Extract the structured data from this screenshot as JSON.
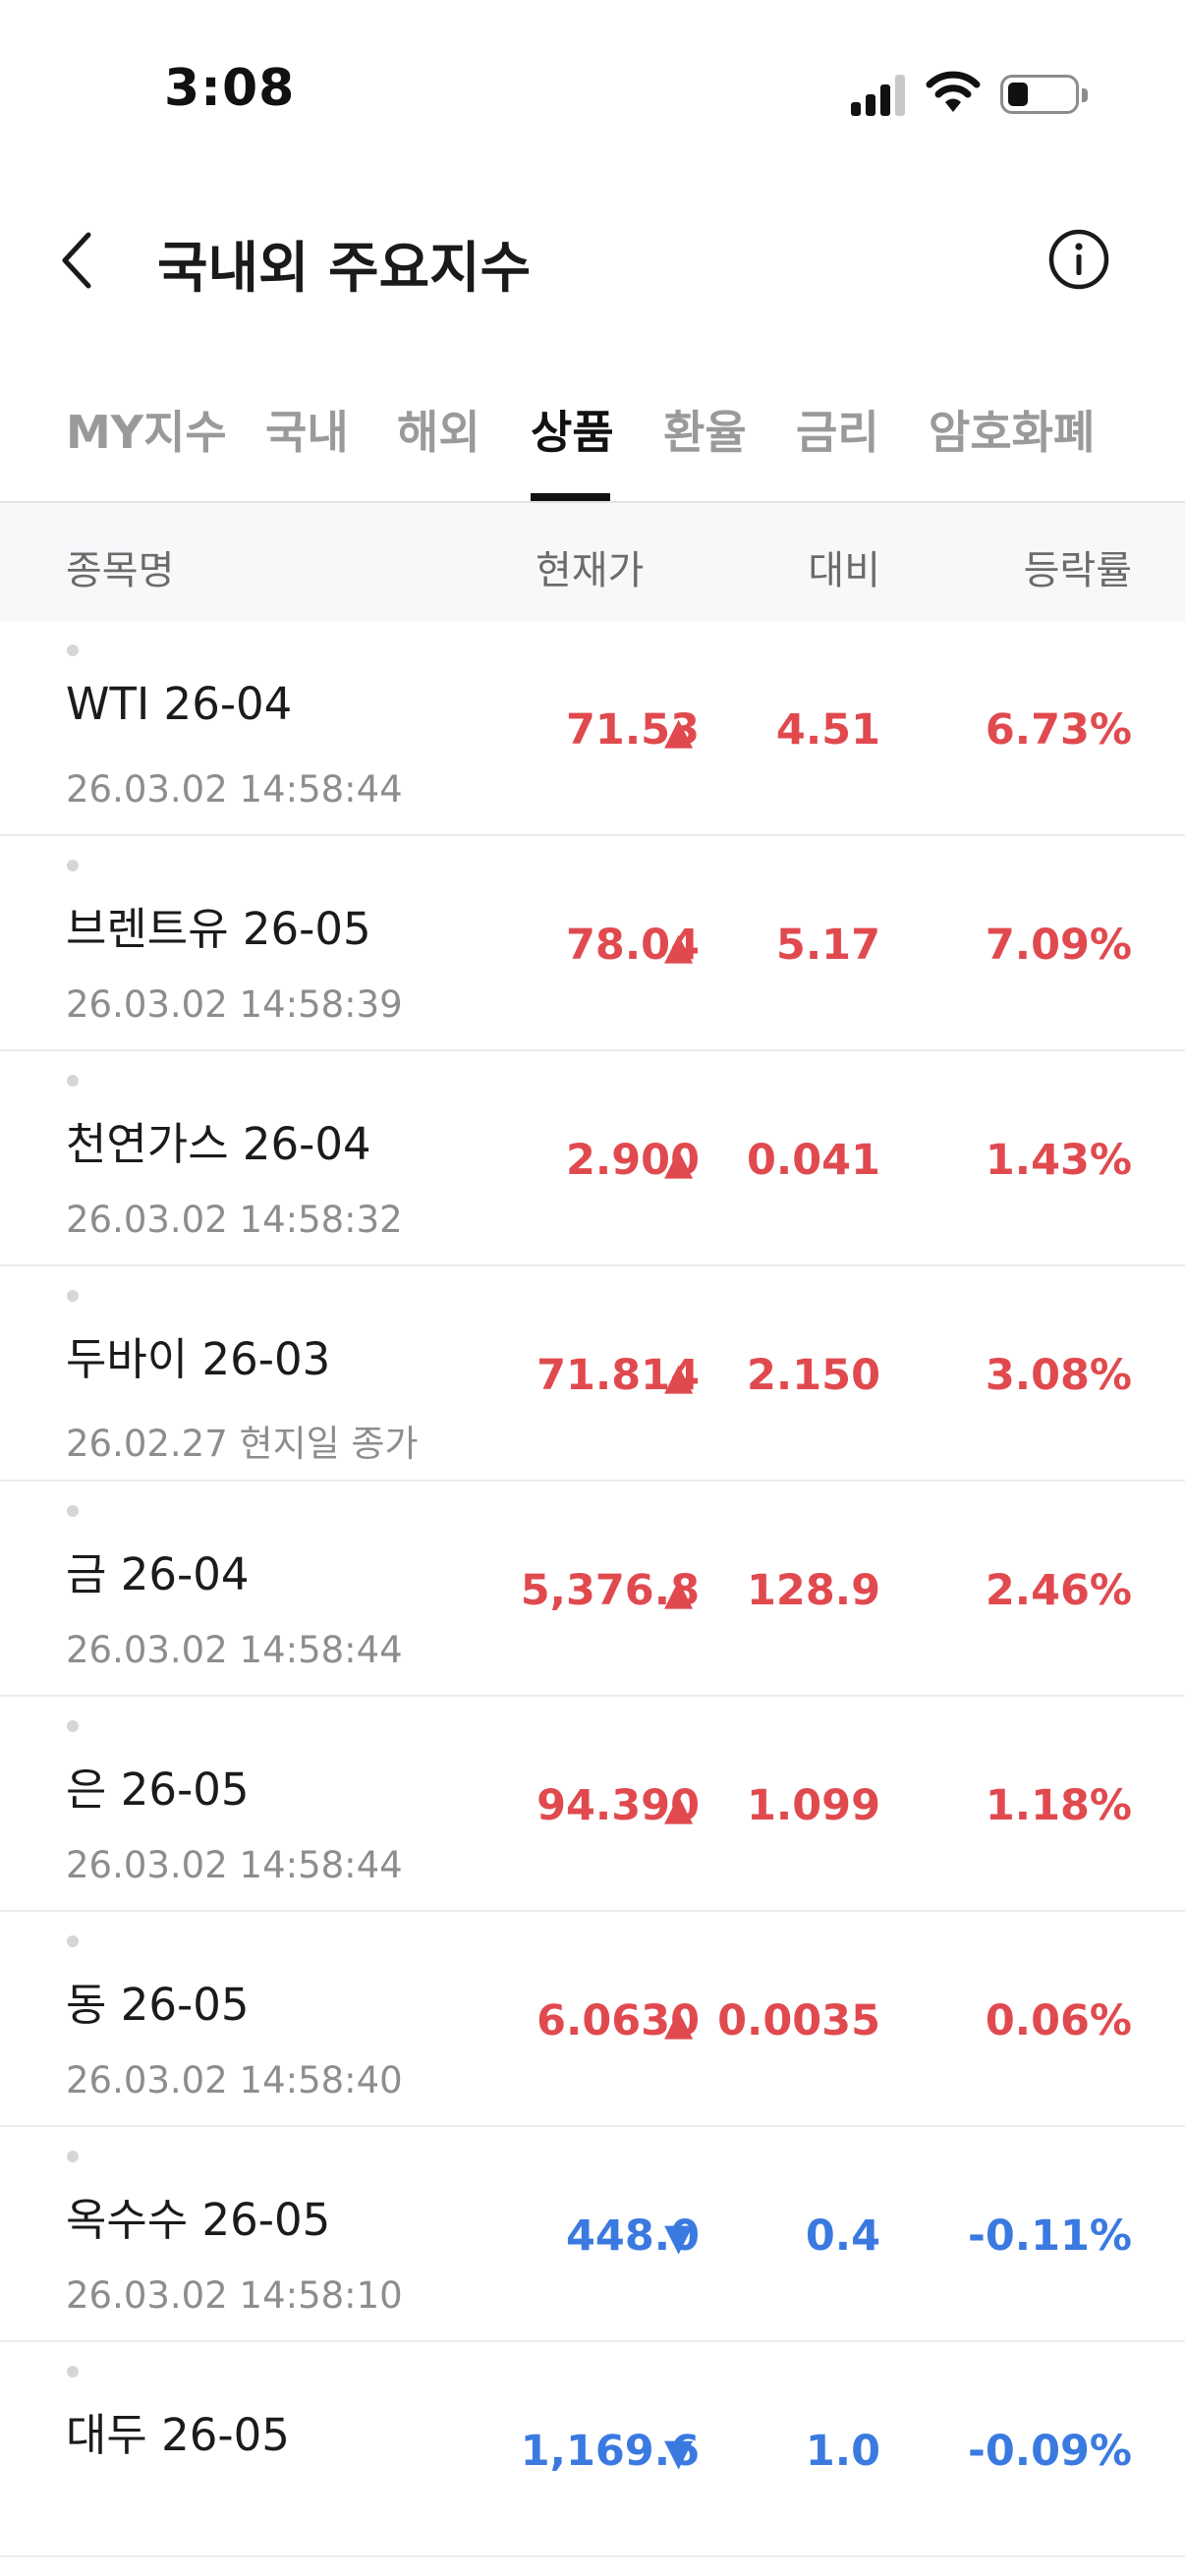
{
  "status_bar": {
    "time": "3:08"
  },
  "header": {
    "title": "국내외 주요지수"
  },
  "tabs": [
    {
      "label": "MY지수"
    },
    {
      "label": "국내"
    },
    {
      "label": "해외"
    },
    {
      "label": "상품"
    },
    {
      "label": "환율"
    },
    {
      "label": "금리"
    },
    {
      "label": "암호화폐"
    }
  ],
  "active_tab": "상품",
  "columns": {
    "name": "종목명",
    "price": "현재가",
    "change": "대비",
    "rate": "등락률"
  },
  "colors": {
    "up": "#e04a4f",
    "down": "#3a7ae0"
  },
  "rows": [
    {
      "name": "WTI 26-04",
      "time": "26.03.02 14:58:44",
      "price": "71.53",
      "direction": "up",
      "arrow": "▲",
      "change": "4.51",
      "rate": "6.73%"
    },
    {
      "name": "브렌트유 26-05",
      "time": "26.03.02 14:58:39",
      "price": "78.04",
      "direction": "up",
      "arrow": "▲",
      "change": "5.17",
      "rate": "7.09%"
    },
    {
      "name": "천연가스 26-04",
      "time": "26.03.02 14:58:32",
      "price": "2.900",
      "direction": "up",
      "arrow": "▲",
      "change": "0.041",
      "rate": "1.43%"
    },
    {
      "name": "두바이 26-03",
      "time": "26.02.27 현지일 종가",
      "price": "71.814",
      "direction": "up",
      "arrow": "▲",
      "change": "2.150",
      "rate": "3.08%"
    },
    {
      "name": "금 26-04",
      "time": "26.03.02 14:58:44",
      "price": "5,376.8",
      "direction": "up",
      "arrow": "▲",
      "change": "128.9",
      "rate": "2.46%"
    },
    {
      "name": "은 26-05",
      "time": "26.03.02 14:58:44",
      "price": "94.390",
      "direction": "up",
      "arrow": "▲",
      "change": "1.099",
      "rate": "1.18%"
    },
    {
      "name": "동 26-05",
      "time": "26.03.02 14:58:40",
      "price": "6.0630",
      "direction": "up",
      "arrow": "▲",
      "change": "0.0035",
      "rate": "0.06%"
    },
    {
      "name": "옥수수 26-05",
      "time": "26.03.02 14:58:10",
      "price": "448.0",
      "direction": "down",
      "arrow": "▼",
      "change": "0.4",
      "rate": "-0.11%"
    },
    {
      "name": "대두 26-05",
      "time": "",
      "price": "1,169.6",
      "direction": "down",
      "arrow": "▼",
      "change": "1.0",
      "rate": "-0.09%"
    }
  ]
}
